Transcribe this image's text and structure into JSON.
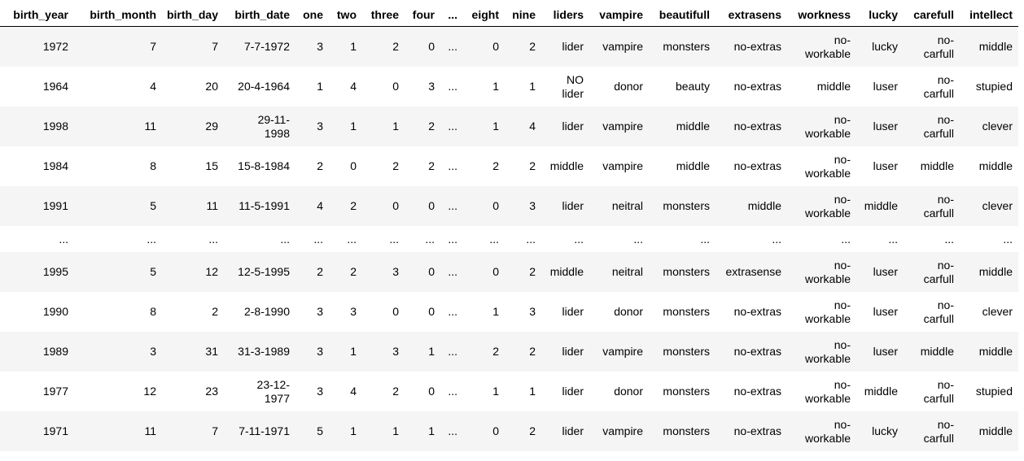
{
  "table": {
    "columns": [
      "birth_year",
      "birth_month",
      "birth_day",
      "birth_date",
      "one",
      "two",
      "three",
      "four",
      "...",
      "eight",
      "nine",
      "liders",
      "vampire",
      "beautifull",
      "extrasens",
      "workness",
      "lucky",
      "carefull",
      "intellect"
    ],
    "rows": [
      [
        "1972",
        "7",
        "7",
        "7-7-1972",
        "3",
        "1",
        "2",
        "0",
        "...",
        "0",
        "2",
        "lider",
        "vampire",
        "monsters",
        "no-extras",
        "no-workable",
        "lucky",
        "no-carfull",
        "middle"
      ],
      [
        "1964",
        "4",
        "20",
        "20-4-1964",
        "1",
        "4",
        "0",
        "3",
        "...",
        "1",
        "1",
        "NO lider",
        "donor",
        "beauty",
        "no-extras",
        "middle",
        "luser",
        "no-carfull",
        "stupied"
      ],
      [
        "1998",
        "11",
        "29",
        "29-11-1998",
        "3",
        "1",
        "1",
        "2",
        "...",
        "1",
        "4",
        "lider",
        "vampire",
        "middle",
        "no-extras",
        "no-workable",
        "luser",
        "no-carfull",
        "clever"
      ],
      [
        "1984",
        "8",
        "15",
        "15-8-1984",
        "2",
        "0",
        "2",
        "2",
        "...",
        "2",
        "2",
        "middle",
        "vampire",
        "middle",
        "no-extras",
        "no-workable",
        "luser",
        "middle",
        "middle"
      ],
      [
        "1991",
        "5",
        "11",
        "11-5-1991",
        "4",
        "2",
        "0",
        "0",
        "...",
        "0",
        "3",
        "lider",
        "neitral",
        "monsters",
        "middle",
        "no-workable",
        "middle",
        "no-carfull",
        "clever"
      ],
      [
        "...",
        "...",
        "...",
        "...",
        "...",
        "...",
        "...",
        "...",
        "...",
        "...",
        "...",
        "...",
        "...",
        "...",
        "...",
        "...",
        "...",
        "...",
        "..."
      ],
      [
        "1995",
        "5",
        "12",
        "12-5-1995",
        "2",
        "2",
        "3",
        "0",
        "...",
        "0",
        "2",
        "middle",
        "neitral",
        "monsters",
        "extrasense",
        "no-workable",
        "luser",
        "no-carfull",
        "middle"
      ],
      [
        "1990",
        "8",
        "2",
        "2-8-1990",
        "3",
        "3",
        "0",
        "0",
        "...",
        "1",
        "3",
        "lider",
        "donor",
        "monsters",
        "no-extras",
        "no-workable",
        "luser",
        "no-carfull",
        "clever"
      ],
      [
        "1989",
        "3",
        "31",
        "31-3-1989",
        "3",
        "1",
        "3",
        "1",
        "...",
        "2",
        "2",
        "lider",
        "vampire",
        "monsters",
        "no-extras",
        "no-workable",
        "luser",
        "middle",
        "middle"
      ],
      [
        "1977",
        "12",
        "23",
        "23-12-1977",
        "3",
        "4",
        "2",
        "0",
        "...",
        "1",
        "1",
        "lider",
        "donor",
        "monsters",
        "no-extras",
        "no-workable",
        "middle",
        "no-carfull",
        "stupied"
      ],
      [
        "1971",
        "11",
        "7",
        "7-11-1971",
        "5",
        "1",
        "1",
        "1",
        "...",
        "0",
        "2",
        "lider",
        "vampire",
        "monsters",
        "no-extras",
        "no-workable",
        "lucky",
        "no-carfull",
        "middle"
      ]
    ]
  }
}
